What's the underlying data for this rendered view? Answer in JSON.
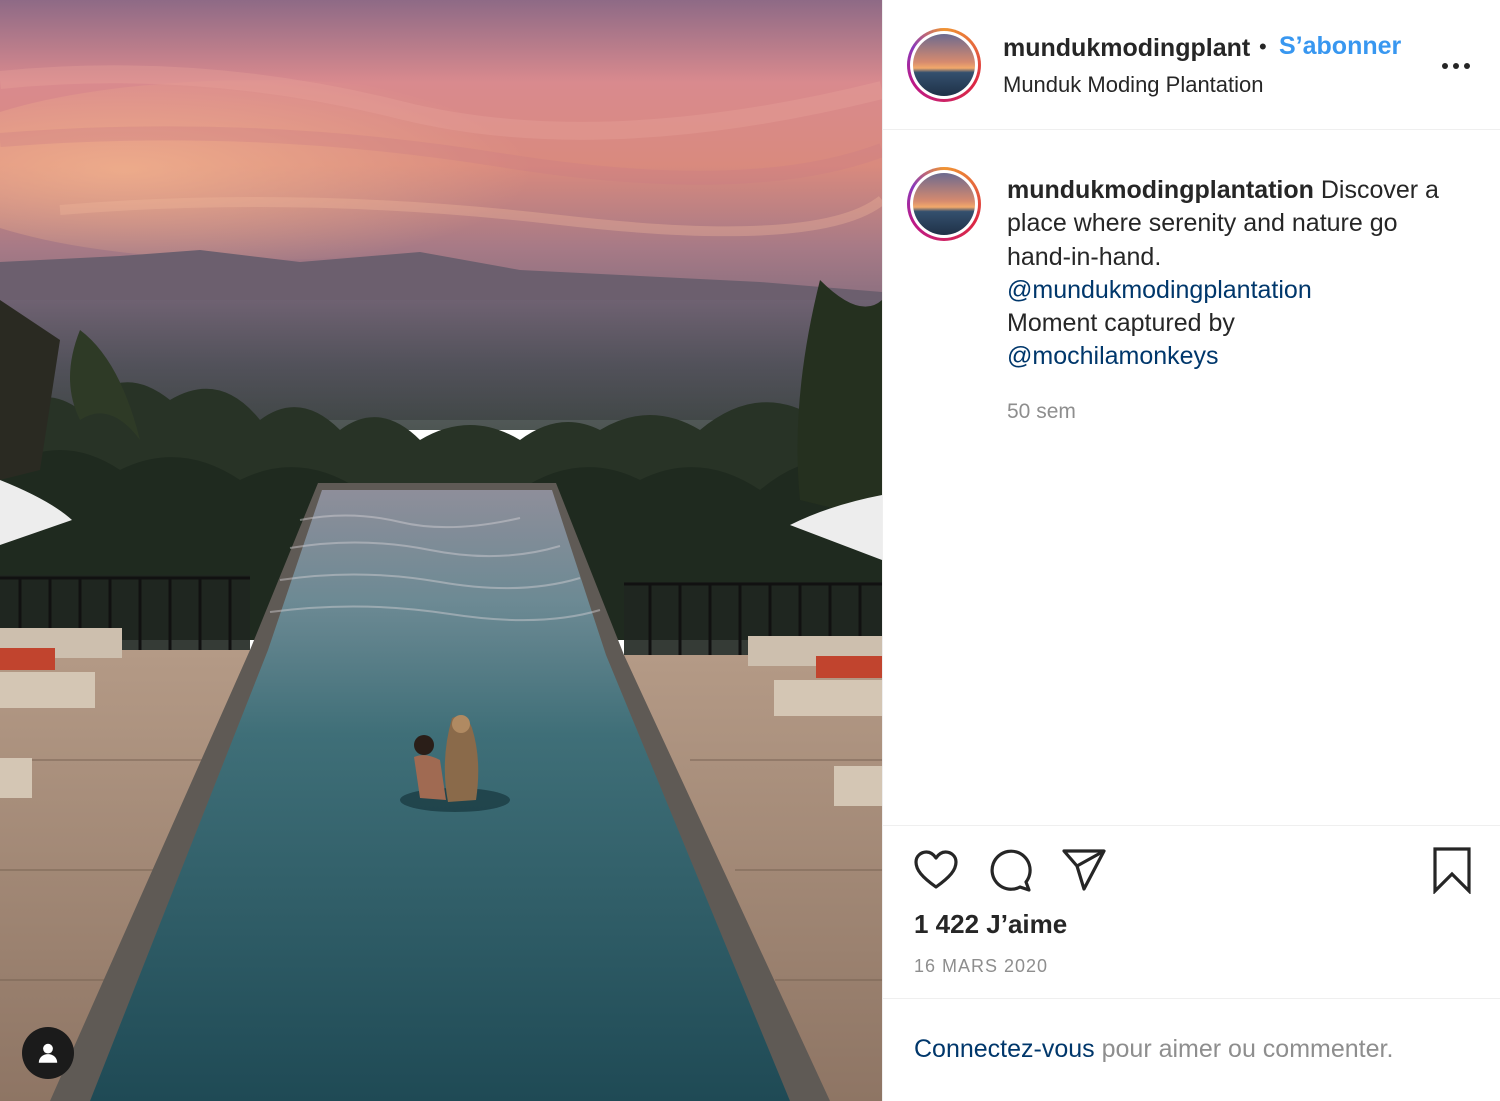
{
  "post": {
    "username": "mundukmodingplantation",
    "header_username": "mundukmodingplantation",
    "separator": "•",
    "follow_label": "S’abonner",
    "location": "Munduk Moding Plantation",
    "caption": {
      "username": "mundukmodingplantation",
      "text": "Discover a place where serenity and nature go hand-in-hand.",
      "mention_1": "@mundukmodingplantation",
      "line_2": "Moment captured by",
      "mention_2": "@mochilamonkeys"
    },
    "time_ago": "50 sem",
    "likes": "1 422 J’aime",
    "date": "16 MARS 2020",
    "login_prompt": {
      "link": "Connectez-vous",
      "rest": " pour aimer ou commenter."
    }
  },
  "colors": {
    "follow": "#3897f0",
    "mention": "#00376b",
    "muted": "#8e8e8e",
    "text": "#262626"
  },
  "icons": {
    "like": "heart-icon",
    "comment": "comment-icon",
    "share": "share-icon",
    "save": "bookmark-icon",
    "more": "more-options-icon",
    "tagged": "user-icon"
  }
}
